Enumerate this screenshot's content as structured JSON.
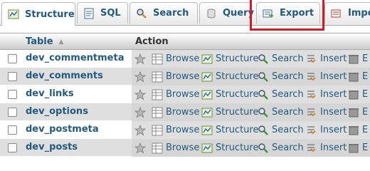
{
  "tabs": [
    {
      "label": "Structure",
      "icon": "structure-icon",
      "active": true
    },
    {
      "label": "SQL",
      "icon": "sql-icon"
    },
    {
      "label": "Search",
      "icon": "search-icon"
    },
    {
      "label": "Query",
      "icon": "query-icon"
    },
    {
      "label": "Export",
      "icon": "export-icon",
      "highlighted": true
    },
    {
      "label": "Impo",
      "icon": "import-icon"
    }
  ],
  "header": {
    "table_label": "Table",
    "action_label": "Action"
  },
  "actions": {
    "browse": "Browse",
    "structure": "Structure",
    "search": "Search",
    "insert": "Insert",
    "empty": "E"
  },
  "rows": [
    {
      "name": "dev_commentmeta"
    },
    {
      "name": "dev_comments"
    },
    {
      "name": "dev_links"
    },
    {
      "name": "dev_options"
    },
    {
      "name": "dev_postmeta"
    },
    {
      "name": "dev_posts"
    }
  ],
  "colors": {
    "link": "#235a81",
    "highlight": "#d31c25"
  }
}
